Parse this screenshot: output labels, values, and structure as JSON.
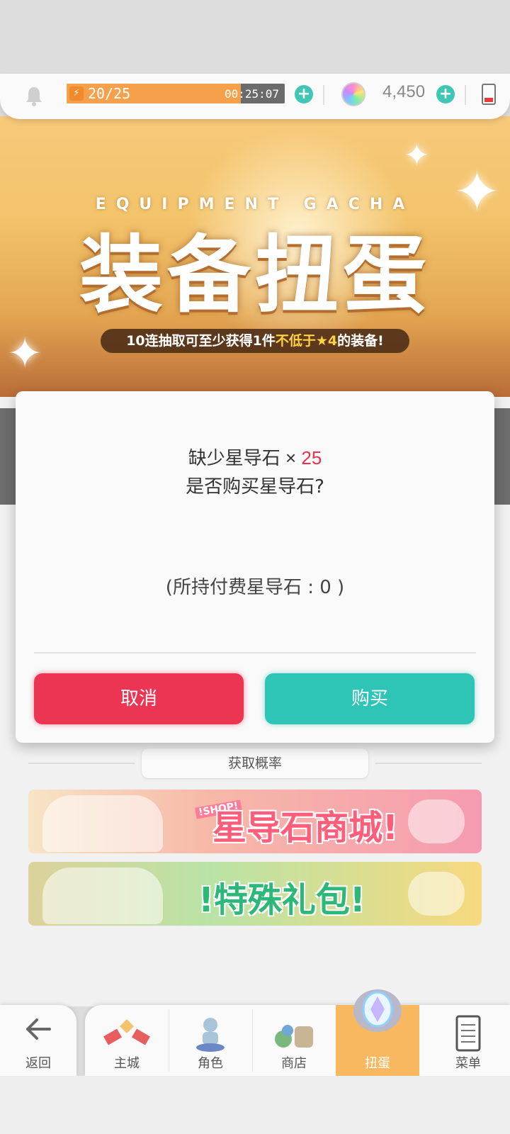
{
  "status_bar": {
    "stamina_count": "20/25",
    "stamina_progress": 0.8,
    "stamina_timer": "00:25:07",
    "gem_count": "4,450"
  },
  "banner": {
    "english_title": "EQUIPMENT GACHA",
    "title": "装备扭蛋",
    "subtitle_part1": "10连抽取可至少获得1件",
    "subtitle_highlight": "不低于★4",
    "subtitle_part2": "的装备!"
  },
  "dialog": {
    "message_prefix": "缺少星导石 × ",
    "message_quantity": "25",
    "question": "是否购买星导石?",
    "held_paid": "(所持付费星导石 : 0 )",
    "cancel_label": "取消",
    "buy_label": "购买",
    "colors": {
      "cancel": "#ec3553",
      "buy": "#2ec4b6",
      "quantity": "#e5334b"
    }
  },
  "odds_button": "获取概率",
  "promos": {
    "shop_tag": "!SHOP!",
    "shop_text": "星导石商城!",
    "pack_text": "!特殊礼包!"
  },
  "nav": {
    "back": "返回",
    "items": [
      "主城",
      "角色",
      "商店",
      "扭蛋",
      "菜单"
    ],
    "active_index": 3
  }
}
